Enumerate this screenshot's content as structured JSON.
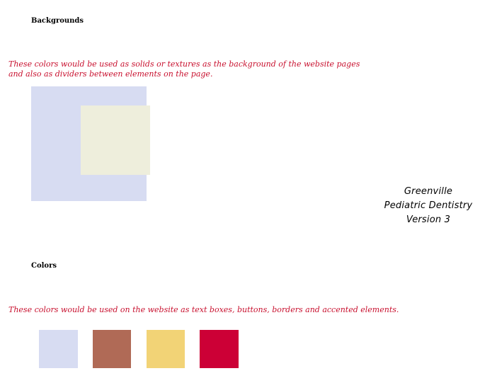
{
  "sections": {
    "backgrounds": {
      "heading": "Backgrounds",
      "description_line1": "These colors would be used as solids or textures as the background of the website pages",
      "description_line2": "and also as dividers between elements on the page.",
      "swatches": [
        "#d7dcf2",
        "#eeeedc"
      ]
    },
    "colors": {
      "heading": "Colors",
      "description": "These colors would be used on the website as text boxes, buttons, borders and accented elements.",
      "swatches": [
        "#d7dcf2",
        "#b06a56",
        "#f2d376",
        "#cc0036"
      ]
    }
  },
  "brand": {
    "line1": "Greenville",
    "line2": "Pediatric Dentistry",
    "line3": "Version 3"
  },
  "accent_color": "#c8102e"
}
